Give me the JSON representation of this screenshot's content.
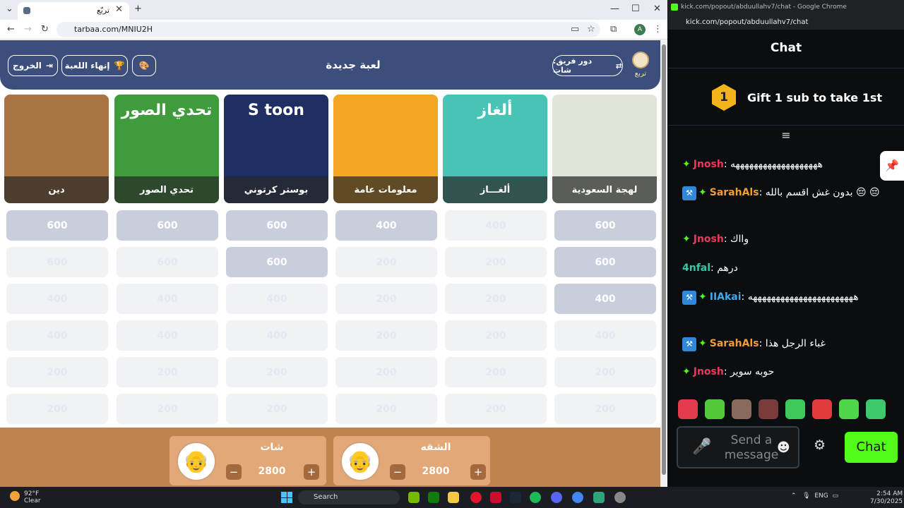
{
  "browser": {
    "tab_title": "تربّع",
    "url": "tarbaa.com/MNIU2H",
    "profile_initial": "A"
  },
  "header": {
    "title": "لعبة جديدة",
    "exit_label": "الخروج",
    "end_game_label": "إنهاء اللعبة",
    "turn_label": "دور فريق: شات",
    "logo_text": "تربع"
  },
  "categories": [
    {
      "label": "دين",
      "icon": "mosque-icon",
      "bg": "#a8743f",
      "title_text": ""
    },
    {
      "label": "تحدي الصور",
      "icon": "photo-challenge-icon",
      "bg": "#3f9b3b",
      "title_text": "تحدي الصور"
    },
    {
      "label": "بوستر كرتوني",
      "icon": "cartoon-poster-icon",
      "bg": "#1f2f64",
      "title_text": "S toon"
    },
    {
      "label": "معلومات عامة",
      "icon": "lightbulb-icon",
      "bg": "#f3a524",
      "title_text": ""
    },
    {
      "label": "ألغـــاز",
      "icon": "cube-icon",
      "bg": "#48c4b6",
      "title_text": "ألغاز"
    },
    {
      "label": "لهجة السعودية",
      "icon": "map-icon",
      "bg": "#dfe6d8",
      "title_text": ""
    }
  ],
  "grid": [
    [
      {
        "v": "600",
        "a": true
      },
      {
        "v": "600",
        "a": true
      },
      {
        "v": "600",
        "a": true
      },
      {
        "v": "400",
        "a": true
      },
      {
        "v": "400",
        "a": false
      },
      {
        "v": "600",
        "a": true
      }
    ],
    [
      {
        "v": "600",
        "a": false
      },
      {
        "v": "600",
        "a": false
      },
      {
        "v": "600",
        "a": true
      },
      {
        "v": "200",
        "a": false
      },
      {
        "v": "200",
        "a": false
      },
      {
        "v": "600",
        "a": true
      }
    ],
    [
      {
        "v": "400",
        "a": false
      },
      {
        "v": "400",
        "a": false
      },
      {
        "v": "400",
        "a": false
      },
      {
        "v": "200",
        "a": false
      },
      {
        "v": "200",
        "a": false
      },
      {
        "v": "400",
        "a": true
      }
    ],
    [
      {
        "v": "400",
        "a": false
      },
      {
        "v": "400",
        "a": false
      },
      {
        "v": "400",
        "a": false
      },
      {
        "v": "200",
        "a": false
      },
      {
        "v": "200",
        "a": false
      },
      {
        "v": "400",
        "a": false
      }
    ],
    [
      {
        "v": "200",
        "a": false
      },
      {
        "v": "200",
        "a": false
      },
      {
        "v": "200",
        "a": false
      },
      {
        "v": "200",
        "a": false
      },
      {
        "v": "200",
        "a": false
      },
      {
        "v": "200",
        "a": false
      }
    ],
    [
      {
        "v": "200",
        "a": false
      },
      {
        "v": "200",
        "a": false
      },
      {
        "v": "200",
        "a": false
      },
      {
        "v": "200",
        "a": false
      },
      {
        "v": "200",
        "a": false
      },
      {
        "v": "200",
        "a": false
      }
    ]
  ],
  "teams": [
    {
      "name": "شات",
      "score": "2800",
      "active": true
    },
    {
      "name": "الشقه",
      "score": "2800",
      "active": false
    }
  ],
  "kick": {
    "window_title": "kick.com/popout/abduullahv7/chat - Google Chrome",
    "url": "kick.com/popout/abduullahv7/chat",
    "chat_title": "Chat",
    "gift_rank": "1",
    "gift_text": "Gift 1 sub to take 1st",
    "messages": [
      {
        "user": "Jnosh",
        "color": "#e93a5b",
        "mod": false,
        "star": true,
        "text": "هههههههههههههههههههه"
      },
      {
        "user": "SarahAls",
        "color": "#f29c38",
        "mod": true,
        "star": true,
        "text": "بدون غش اقسم بالله 😔 😔"
      },
      {
        "user": "Jnosh",
        "color": "#e93a5b",
        "mod": false,
        "star": true,
        "text": "وااك"
      },
      {
        "user": "4nfal",
        "color": "#36c9a6",
        "mod": false,
        "star": false,
        "text": "درهم"
      },
      {
        "user": "IIAkai",
        "color": "#3fa8ef",
        "mod": true,
        "star": true,
        "text": "هههههههههههههههههههههههه"
      },
      {
        "user": "SarahAls",
        "color": "#f29c38",
        "mod": true,
        "star": true,
        "text": "غباء الرجل هذا"
      },
      {
        "user": "Jnosh",
        "color": "#e93a5b",
        "mod": false,
        "star": true,
        "text": "حوبه سوير"
      }
    ],
    "input_placeholder": "Send a message",
    "send_label": "Chat",
    "emote_colors": [
      "#e23b4d",
      "#53c93a",
      "#8a6a5a",
      "#7b3b3b",
      "#3ec95a",
      "#e23b3b",
      "#4ed64a",
      "#3ec96a"
    ]
  },
  "taskbar": {
    "temp": "92°F",
    "weather": "Clear",
    "search": "Search",
    "lang": "ENG",
    "time": "2:54 AM",
    "date": "7/30/2025"
  }
}
